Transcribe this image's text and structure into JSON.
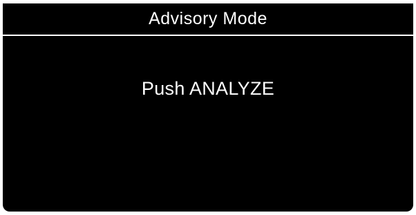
{
  "header": {
    "title": "Advisory Mode"
  },
  "main": {
    "prompt": "Push ANALYZE"
  },
  "colors": {
    "background": "#000000",
    "text": "#ffffff",
    "divider": "#ffffff"
  }
}
